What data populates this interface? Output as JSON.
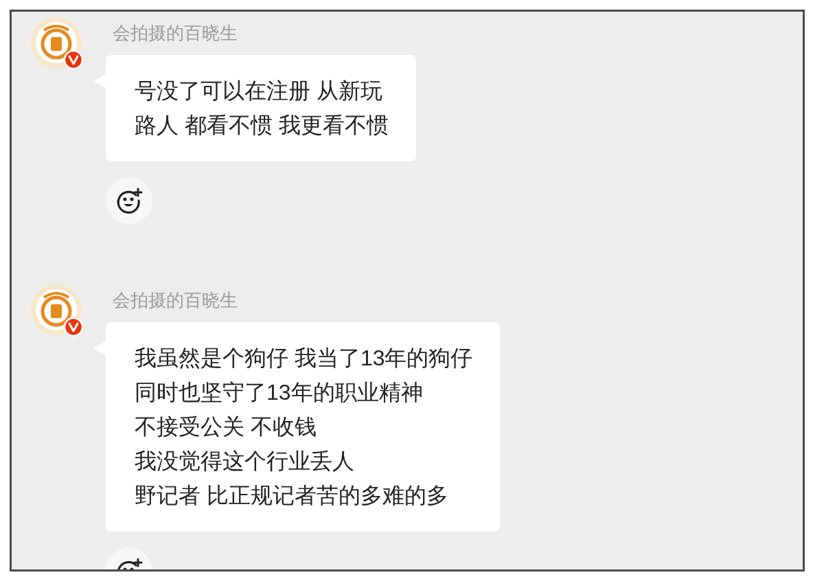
{
  "messages": [
    {
      "sender": "会拍摄的百晓生",
      "verified": true,
      "lines": [
        "号没了可以在注册 从新玩",
        "路人 都看不惯 我更看不惯"
      ]
    },
    {
      "sender": "会拍摄的百晓生",
      "verified": true,
      "lines": [
        "我虽然是个狗仔 我当了13年的狗仔",
        "同时也坚守了13年的职业精神",
        "不接受公关 不收钱",
        "我没觉得这个行业丢人",
        "野记者 比正规记者苦的多难的多"
      ]
    }
  ]
}
